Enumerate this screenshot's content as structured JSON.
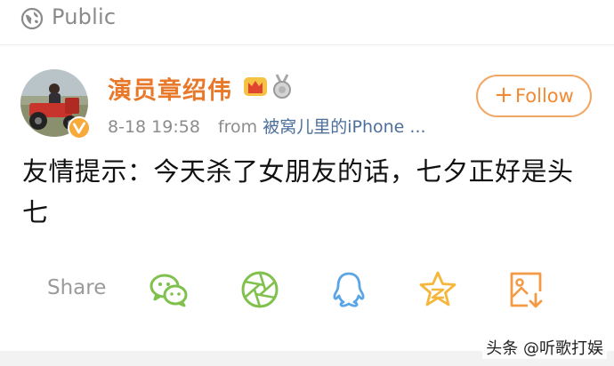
{
  "header": {
    "visibility_icon": "globe-icon",
    "visibility_label": "Public"
  },
  "post": {
    "author": {
      "name": "演员章绍伟",
      "avatar": "avatar-image",
      "verified_icon": "verified-v-icon",
      "badges": [
        "crown-badge-icon",
        "medal-badge-icon"
      ]
    },
    "time": "8-18 19:58",
    "source_prefix": "from",
    "source_device": "被窝儿里的iPhone ...",
    "follow_button": {
      "icon": "plus",
      "label": "Follow"
    },
    "text": "友情提示：今天杀了女朋友的话，七夕正好是头七"
  },
  "share_bar": {
    "label": "Share",
    "targets": [
      "wechat-icon",
      "moments-icon",
      "qq-icon",
      "qzone-icon",
      "save-image-icon"
    ]
  },
  "watermark": "头条 @听歌打娱",
  "colors": {
    "accent_orange": "#f28a33",
    "username_orange": "#e8782a",
    "source_blue": "#4d6f9b",
    "icon_green": "#7fc14c",
    "icon_blue": "#5aa5e6",
    "icon_yellow": "#f5b73b",
    "icon_orange": "#f29a45"
  }
}
